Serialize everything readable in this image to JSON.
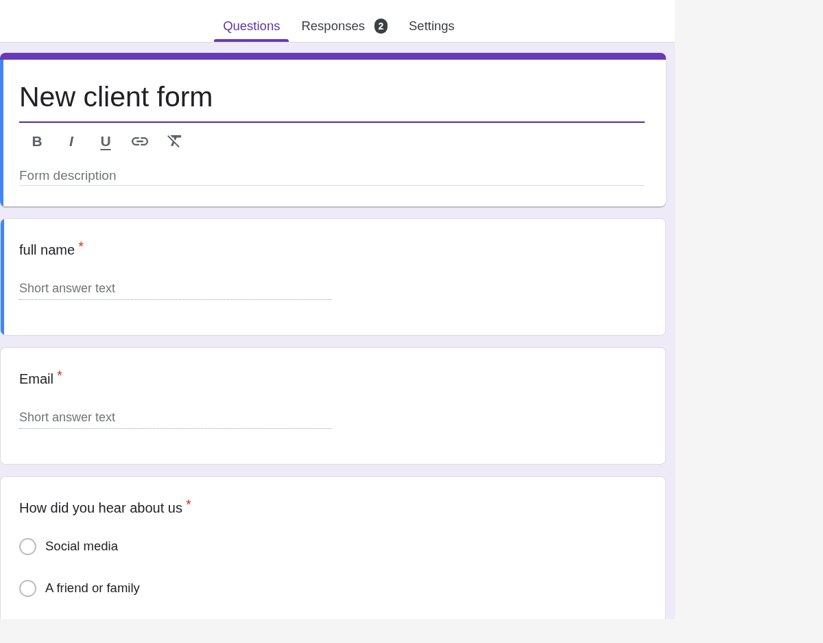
{
  "tabs": [
    {
      "label": "Questions",
      "selected": true
    },
    {
      "label": "Responses",
      "selected": false,
      "badge": "2"
    },
    {
      "label": "Settings",
      "selected": false
    }
  ],
  "form_header": {
    "title": "New client form",
    "focused": true,
    "toolbar": [
      {
        "kind": "bold",
        "glyph": "B"
      },
      {
        "kind": "italic",
        "glyph": "I"
      },
      {
        "kind": "underline",
        "glyph": "U"
      },
      {
        "kind": "link"
      },
      {
        "kind": "clear_format"
      }
    ],
    "description": {
      "placeholder": "Form description"
    }
  },
  "questions": [
    {
      "kind": "short_answer",
      "title": "full name",
      "required_mark": "*",
      "focused": true,
      "answer": {
        "placeholder": "Short answer text"
      }
    },
    {
      "kind": "short_answer",
      "title": "Email",
      "required_mark": "*",
      "focused": false,
      "answer": {
        "placeholder": "Short answer text"
      }
    },
    {
      "kind": "multiple_choice",
      "title": "How did you hear about us",
      "required_mark": "*",
      "focused": false,
      "options": [
        {
          "label": "Social media",
          "selected": false
        },
        {
          "label": "A friend or family",
          "selected": false
        }
      ]
    }
  ]
}
